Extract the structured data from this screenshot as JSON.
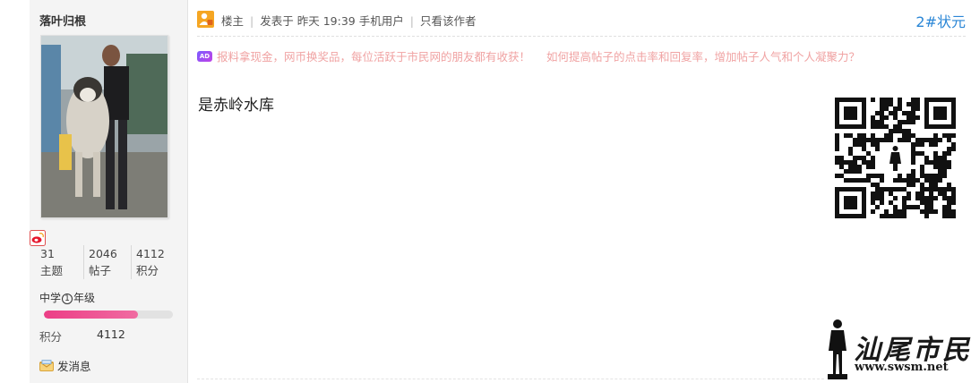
{
  "user": {
    "name": "落叶归根",
    "stats": [
      {
        "value": "31",
        "label": "主题"
      },
      {
        "value": "2046",
        "label": "帖子"
      },
      {
        "value": "4112",
        "label": "积分"
      }
    ],
    "grade_prefix": "中学",
    "grade_circle": "1",
    "grade_suffix": "年级",
    "progress_fraction": 0.73,
    "score_label": "积分",
    "score_value": "4112",
    "message_label": "发消息"
  },
  "post": {
    "host_label": "楼主",
    "posted_prefix": "发表于",
    "posted_time": "昨天 19:39",
    "device": "手机用户",
    "author_only": "只看该作者",
    "floor": "2#状元",
    "body": "是赤岭水库"
  },
  "ads": {
    "badge": "AD",
    "links": [
      "报料拿现金，网币换奖品，每位活跃于市民网的朋友都有收获！",
      "如何提高帖子的点击率和回复率，增加帖子人气和个人凝聚力？"
    ]
  },
  "watermark": {
    "title": "汕尾市民网",
    "url": "www.swsm.net"
  },
  "colors": {
    "accent": "#2a86d6",
    "ad_text": "#f0a3a3",
    "progress": "#ec3e86",
    "sidebar_bg": "#f4f4f4"
  }
}
